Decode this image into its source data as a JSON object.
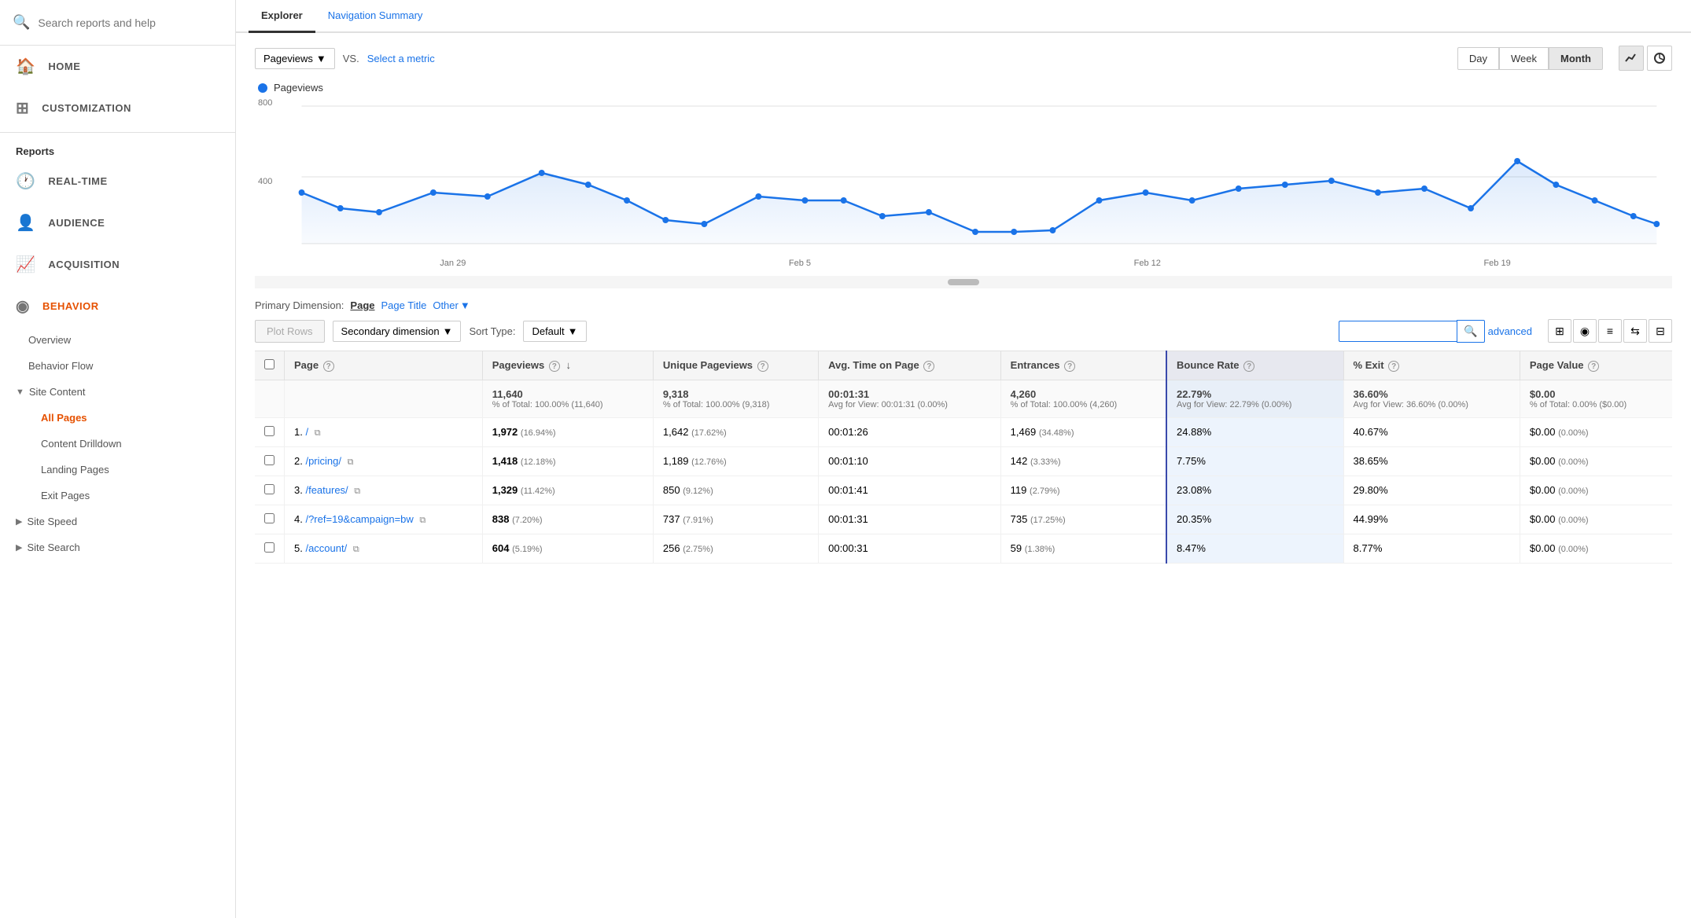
{
  "sidebar": {
    "search_placeholder": "Search reports and help",
    "nav_items": [
      {
        "id": "home",
        "label": "HOME",
        "icon": "🏠"
      },
      {
        "id": "customization",
        "label": "CUSTOMIZATION",
        "icon": "⊞"
      }
    ],
    "sections": {
      "reports_label": "Reports",
      "items": [
        {
          "id": "realtime",
          "label": "REAL-TIME",
          "icon": "🕐"
        },
        {
          "id": "audience",
          "label": "AUDIENCE",
          "icon": "👤"
        },
        {
          "id": "acquisition",
          "label": "ACQUISITION",
          "icon": "📈"
        },
        {
          "id": "behavior",
          "label": "BEHAVIOR",
          "icon": "◉",
          "active": true
        }
      ],
      "behavior_sub": [
        {
          "id": "overview",
          "label": "Overview"
        },
        {
          "id": "behavior-flow",
          "label": "Behavior Flow"
        }
      ],
      "site_content_label": "Site Content",
      "site_content_sub": [
        {
          "id": "all-pages",
          "label": "All Pages",
          "active": true
        },
        {
          "id": "content-drilldown",
          "label": "Content Drilldown"
        },
        {
          "id": "landing-pages",
          "label": "Landing Pages"
        },
        {
          "id": "exit-pages",
          "label": "Exit Pages"
        }
      ],
      "site_speed_label": "Site Speed",
      "site_search_label": "Site Search"
    }
  },
  "tabs": [
    {
      "id": "explorer",
      "label": "Explorer",
      "active": true
    },
    {
      "id": "navigation-summary",
      "label": "Navigation Summary",
      "active": false
    }
  ],
  "chart": {
    "metric_dropdown": "Pageviews",
    "vs_label": "VS.",
    "select_metric": "Select a metric",
    "legend_label": "Pageviews",
    "y_label_800": "800",
    "y_label_400": "400",
    "x_labels": [
      "Jan 29",
      "Feb 5",
      "Feb 12",
      "Feb 19"
    ],
    "time_buttons": [
      "Day",
      "Week",
      "Month"
    ],
    "active_time": "Month"
  },
  "dimension": {
    "label": "Primary Dimension:",
    "page": "Page",
    "page_title": "Page Title",
    "other": "Other"
  },
  "table_controls": {
    "plot_rows": "Plot Rows",
    "secondary_dimension": "Secondary dimension",
    "sort_type_label": "Sort Type:",
    "sort_default": "Default",
    "advanced": "advanced"
  },
  "table": {
    "columns": [
      {
        "id": "page",
        "label": "Page",
        "has_info": true
      },
      {
        "id": "pageviews",
        "label": "Pageviews",
        "has_info": true,
        "sort_active": true
      },
      {
        "id": "unique-pageviews",
        "label": "Unique Pageviews",
        "has_info": true
      },
      {
        "id": "avg-time",
        "label": "Avg. Time on Page",
        "has_info": true
      },
      {
        "id": "entrances",
        "label": "Entrances",
        "has_info": true
      },
      {
        "id": "bounce-rate",
        "label": "Bounce Rate",
        "has_info": true
      },
      {
        "id": "pct-exit",
        "label": "% Exit",
        "has_info": true
      },
      {
        "id": "page-value",
        "label": "Page Value",
        "has_info": true
      }
    ],
    "totals": {
      "pageviews": "11,640",
      "pageviews_sub": "% of Total: 100.00% (11,640)",
      "unique": "9,318",
      "unique_sub": "% of Total: 100.00% (9,318)",
      "avg_time": "00:01:31",
      "avg_time_sub": "Avg for View: 00:01:31 (0.00%)",
      "entrances": "4,260",
      "entrances_sub": "% of Total: 100.00% (4,260)",
      "bounce_rate": "22.79%",
      "bounce_rate_sub": "Avg for View: 22.79% (0.00%)",
      "pct_exit": "36.60%",
      "pct_exit_sub": "Avg for View: 36.60% (0.00%)",
      "page_value": "$0.00",
      "page_value_sub": "% of Total: 0.00% ($0.00)"
    },
    "rows": [
      {
        "num": "1.",
        "page": "/",
        "pageviews": "1,972",
        "pageviews_pct": "(16.94%)",
        "unique": "1,642",
        "unique_pct": "(17.62%)",
        "avg_time": "00:01:26",
        "entrances": "1,469",
        "entrances_pct": "(34.48%)",
        "bounce_rate": "24.88%",
        "pct_exit": "40.67%",
        "page_value": "$0.00",
        "page_value_pct": "(0.00%)"
      },
      {
        "num": "2.",
        "page": "/pricing/",
        "pageviews": "1,418",
        "pageviews_pct": "(12.18%)",
        "unique": "1,189",
        "unique_pct": "(12.76%)",
        "avg_time": "00:01:10",
        "entrances": "142",
        "entrances_pct": "(3.33%)",
        "bounce_rate": "7.75%",
        "pct_exit": "38.65%",
        "page_value": "$0.00",
        "page_value_pct": "(0.00%)"
      },
      {
        "num": "3.",
        "page": "/features/",
        "pageviews": "1,329",
        "pageviews_pct": "(11.42%)",
        "unique": "850",
        "unique_pct": "(9.12%)",
        "avg_time": "00:01:41",
        "entrances": "119",
        "entrances_pct": "(2.79%)",
        "bounce_rate": "23.08%",
        "pct_exit": "29.80%",
        "page_value": "$0.00",
        "page_value_pct": "(0.00%)"
      },
      {
        "num": "4.",
        "page": "/?ref=19&campaign=bw",
        "pageviews": "838",
        "pageviews_pct": "(7.20%)",
        "unique": "737",
        "unique_pct": "(7.91%)",
        "avg_time": "00:01:31",
        "entrances": "735",
        "entrances_pct": "(17.25%)",
        "bounce_rate": "20.35%",
        "pct_exit": "44.99%",
        "page_value": "$0.00",
        "page_value_pct": "(0.00%)"
      },
      {
        "num": "5.",
        "page": "/account/",
        "pageviews": "604",
        "pageviews_pct": "(5.19%)",
        "unique": "256",
        "unique_pct": "(2.75%)",
        "avg_time": "00:00:31",
        "entrances": "59",
        "entrances_pct": "(1.38%)",
        "bounce_rate": "8.47%",
        "pct_exit": "8.77%",
        "page_value": "$0.00",
        "page_value_pct": "(0.00%)"
      }
    ]
  }
}
